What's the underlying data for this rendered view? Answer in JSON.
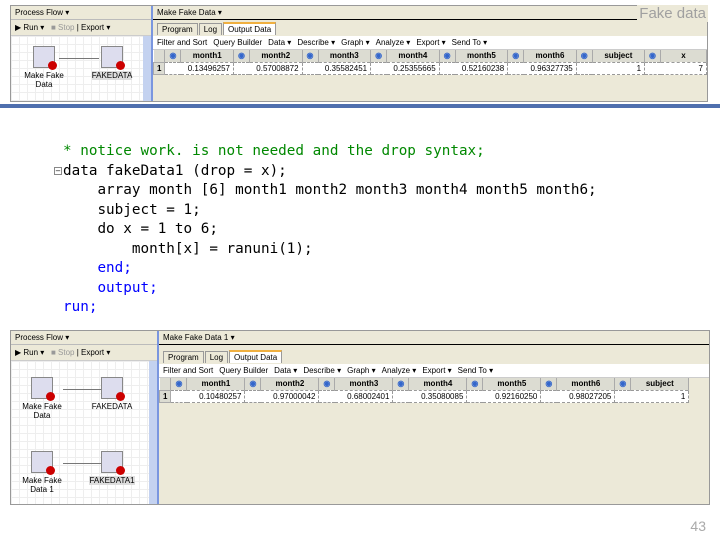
{
  "slide_title": "Fake data",
  "page_number": "43",
  "top_shot": {
    "process_flow": {
      "title": "Process Flow ▾",
      "toolbar": [
        "▶ Run ▾",
        "■ Stop",
        "Export ▾"
      ],
      "nodes": [
        {
          "label": "Make Fake Data"
        },
        {
          "label": "FAKEDATA"
        }
      ]
    },
    "main": {
      "title": "Make Fake Data ▾",
      "tabs": [
        "Program",
        "Log",
        "Output Data"
      ],
      "toolbar": [
        "Filter and Sort",
        "Query Builder",
        "Data ▾",
        "Describe ▾",
        "Graph ▾",
        "Analyze ▾",
        "Export ▾",
        "Send To ▾"
      ],
      "columns": [
        "month1",
        "month2",
        "month3",
        "month4",
        "month5",
        "month6",
        "subject",
        "x"
      ],
      "rows": [
        {
          "n": "1",
          "cells": [
            "0.13496257",
            "0.57008872",
            "0.35582451",
            "0.25355665",
            "0.52160238",
            "0.96327735",
            "1",
            "7"
          ]
        }
      ]
    }
  },
  "code": {
    "lines": [
      "* notice work. is not needed and the drop syntax;",
      "data fakeData1 (drop = x);",
      "array month [6] month1 month2 month3 month4 month5 month6;",
      "subject = 1;",
      "do x = 1 to 6;",
      "month[x] = ranuni(1);",
      "end;",
      "output;",
      "run;"
    ]
  },
  "bottom_shot": {
    "process_flow": {
      "title": "Process Flow ▾",
      "toolbar": [
        "▶ Run ▾",
        "■ Stop",
        "Export ▾"
      ],
      "nodes": [
        {
          "label": "Make Fake Data"
        },
        {
          "label": "FAKEDATA"
        },
        {
          "label": "Make Fake Data 1"
        },
        {
          "label": "FAKEDATA1"
        }
      ]
    },
    "main": {
      "title": "Make Fake Data 1 ▾",
      "tabs": [
        "Program",
        "Log",
        "Output Data"
      ],
      "toolbar": [
        "Filter and Sort",
        "Query Builder",
        "Data ▾",
        "Describe ▾",
        "Graph ▾",
        "Analyze ▾",
        "Export ▾",
        "Send To ▾"
      ],
      "columns": [
        "month1",
        "month2",
        "month3",
        "month4",
        "month5",
        "month6",
        "subject"
      ],
      "rows": [
        {
          "n": "1",
          "cells": [
            "0.10480257",
            "0.97000042",
            "0.68002401",
            "0.35080085",
            "0.92160250",
            "0.98027205",
            "1"
          ]
        }
      ]
    }
  }
}
